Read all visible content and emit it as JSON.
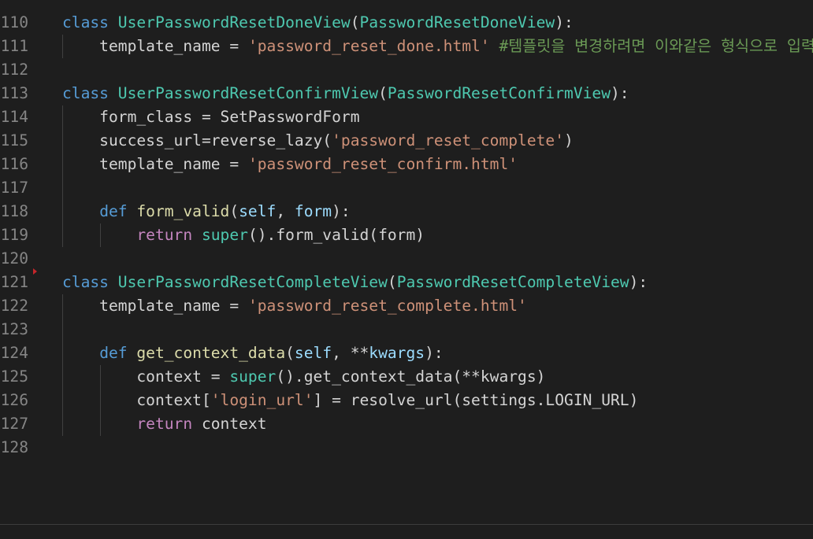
{
  "editor": {
    "lines": [
      {
        "n": "110",
        "tokens": [
          {
            "t": "class",
            "c": "kw"
          },
          {
            "t": " ",
            "c": "pl"
          },
          {
            "t": "UserPasswordResetDoneView",
            "c": "cls"
          },
          {
            "t": "(",
            "c": "pl"
          },
          {
            "t": "PasswordResetDoneView",
            "c": "cls"
          },
          {
            "t": "):",
            "c": "pl"
          }
        ]
      },
      {
        "n": "111",
        "tokens": [
          {
            "t": "    template_name = ",
            "c": "pl"
          },
          {
            "t": "'password_reset_done.html'",
            "c": "str"
          },
          {
            "t": " ",
            "c": "pl"
          },
          {
            "t": "#템플릿을 변경하려면 이와같은 형식으로 입력",
            "c": "cmt"
          }
        ]
      },
      {
        "n": "112",
        "tokens": []
      },
      {
        "n": "113",
        "tokens": [
          {
            "t": "class",
            "c": "kw"
          },
          {
            "t": " ",
            "c": "pl"
          },
          {
            "t": "UserPasswordResetConfirmView",
            "c": "cls"
          },
          {
            "t": "(",
            "c": "pl"
          },
          {
            "t": "PasswordResetConfirmView",
            "c": "cls"
          },
          {
            "t": "):",
            "c": "pl"
          }
        ]
      },
      {
        "n": "114",
        "tokens": [
          {
            "t": "    form_class = SetPasswordForm",
            "c": "pl"
          }
        ]
      },
      {
        "n": "115",
        "tokens": [
          {
            "t": "    success_url=reverse_lazy(",
            "c": "pl"
          },
          {
            "t": "'password_reset_complete'",
            "c": "str"
          },
          {
            "t": ")",
            "c": "pl"
          }
        ]
      },
      {
        "n": "116",
        "tokens": [
          {
            "t": "    template_name = ",
            "c": "pl"
          },
          {
            "t": "'password_reset_confirm.html'",
            "c": "str"
          }
        ]
      },
      {
        "n": "117",
        "tokens": []
      },
      {
        "n": "118",
        "tokens": [
          {
            "t": "    ",
            "c": "pl"
          },
          {
            "t": "def",
            "c": "kw"
          },
          {
            "t": " ",
            "c": "pl"
          },
          {
            "t": "form_valid",
            "c": "fn"
          },
          {
            "t": "(",
            "c": "pl"
          },
          {
            "t": "self",
            "c": "param"
          },
          {
            "t": ", ",
            "c": "pl"
          },
          {
            "t": "form",
            "c": "param"
          },
          {
            "t": "):",
            "c": "pl"
          }
        ]
      },
      {
        "n": "119",
        "tokens": [
          {
            "t": "        ",
            "c": "pl"
          },
          {
            "t": "return",
            "c": "kw2"
          },
          {
            "t": " ",
            "c": "pl"
          },
          {
            "t": "super",
            "c": "cls"
          },
          {
            "t": "().form_valid(form)",
            "c": "pl"
          }
        ]
      },
      {
        "n": "120",
        "tokens": []
      },
      {
        "n": "121",
        "tokens": [
          {
            "t": "class",
            "c": "kw"
          },
          {
            "t": " ",
            "c": "pl"
          },
          {
            "t": "UserPasswordResetCompleteView",
            "c": "cls"
          },
          {
            "t": "(",
            "c": "pl"
          },
          {
            "t": "PasswordResetCompleteView",
            "c": "cls"
          },
          {
            "t": "):",
            "c": "pl"
          }
        ]
      },
      {
        "n": "122",
        "tokens": [
          {
            "t": "    template_name = ",
            "c": "pl"
          },
          {
            "t": "'password_reset_complete.html'",
            "c": "str"
          }
        ]
      },
      {
        "n": "123",
        "tokens": []
      },
      {
        "n": "124",
        "tokens": [
          {
            "t": "    ",
            "c": "pl"
          },
          {
            "t": "def",
            "c": "kw"
          },
          {
            "t": " ",
            "c": "pl"
          },
          {
            "t": "get_context_data",
            "c": "fn"
          },
          {
            "t": "(",
            "c": "pl"
          },
          {
            "t": "self",
            "c": "param"
          },
          {
            "t": ", **",
            "c": "pl"
          },
          {
            "t": "kwargs",
            "c": "param"
          },
          {
            "t": "):",
            "c": "pl"
          }
        ]
      },
      {
        "n": "125",
        "tokens": [
          {
            "t": "        context = ",
            "c": "pl"
          },
          {
            "t": "super",
            "c": "cls"
          },
          {
            "t": "().get_context_data(**kwargs)",
            "c": "pl"
          }
        ]
      },
      {
        "n": "126",
        "tokens": [
          {
            "t": "        context[",
            "c": "pl"
          },
          {
            "t": "'login_url'",
            "c": "str"
          },
          {
            "t": "] = resolve_url(settings.LOGIN_URL)",
            "c": "pl"
          }
        ]
      },
      {
        "n": "127",
        "tokens": [
          {
            "t": "        ",
            "c": "pl"
          },
          {
            "t": "return",
            "c": "kw2"
          },
          {
            "t": " context",
            "c": "pl"
          }
        ]
      },
      {
        "n": "128",
        "tokens": []
      }
    ]
  },
  "colors": {
    "background": "#1e1e1e",
    "line_number": "#858585",
    "keyword": "#569cd6",
    "control_keyword": "#c586c0",
    "class_name": "#4ec9b0",
    "function_name": "#dcdcaa",
    "string": "#ce9178",
    "comment": "#6a9955",
    "parameter": "#9cdcfe",
    "text": "#d4d4d4",
    "error_marker": "#c5262b"
  }
}
